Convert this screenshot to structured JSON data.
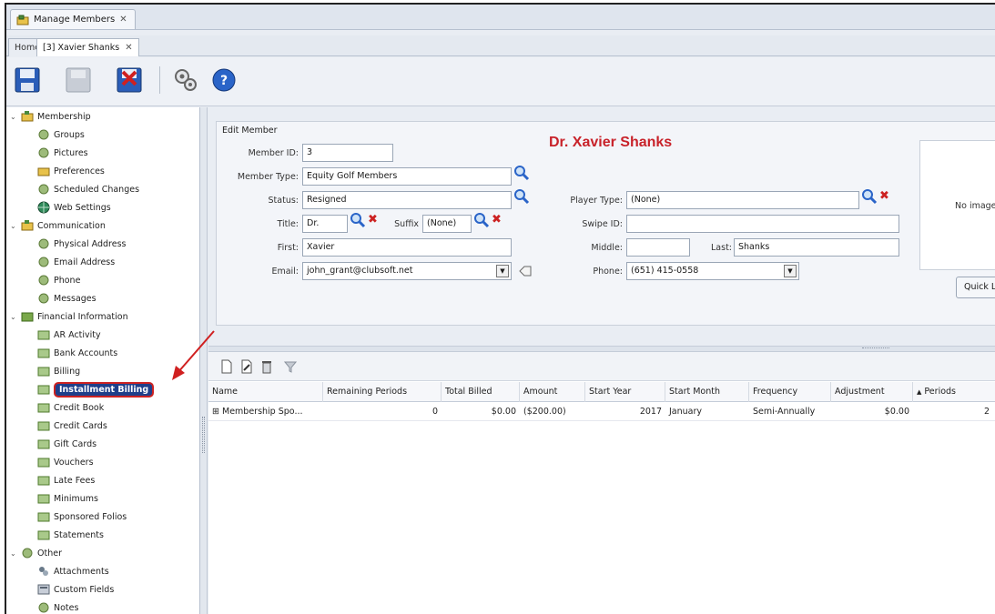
{
  "window": {
    "doc_tab": "Manage Members",
    "tabs": [
      {
        "label": "Home"
      },
      {
        "label": "[3] Xavier Shanks"
      }
    ]
  },
  "nav": {
    "groups": [
      {
        "label": "Membership",
        "items": [
          "Groups",
          "Pictures",
          "Preferences",
          "Scheduled Changes",
          "Web Settings"
        ]
      },
      {
        "label": "Communication",
        "items": [
          "Physical Address",
          "Email Address",
          "Phone",
          "Messages"
        ]
      },
      {
        "label": "Financial Information",
        "items": [
          "AR Activity",
          "Bank Accounts",
          "Billing",
          "Installment Billing",
          "Credit Book",
          "Credit Cards",
          "Gift Cards",
          "Vouchers",
          "Late Fees",
          "Minimums",
          "Sponsored Folios",
          "Statements"
        ]
      },
      {
        "label": "Other",
        "items": [
          "Attachments",
          "Custom Fields",
          "Notes"
        ]
      }
    ],
    "selected": "Installment Billing"
  },
  "edit_member": {
    "title": "Edit Member",
    "member_name": "Dr. Xavier Shanks",
    "labels": {
      "member_id": "Member ID:",
      "member_type": "Member Type:",
      "status": "Status:",
      "title": "Title:",
      "suffix": "Suffix",
      "first": "First:",
      "email": "Email:",
      "player_type": "Player Type:",
      "swipe_id": "Swipe ID:",
      "middle": "Middle:",
      "last": "Last:",
      "phone": "Phone:"
    },
    "values": {
      "member_id": "3",
      "member_type": "Equity Golf Members",
      "status": "Resigned",
      "title": "Dr.",
      "suffix": "(None)",
      "first": "Xavier",
      "email": "john_grant@clubsoft.net",
      "player_type": "(None)",
      "swipe_id": "",
      "middle": "",
      "last": "Shanks",
      "phone": "(651) 415-0558"
    },
    "no_image": "No image",
    "quick_button": "Quick La"
  },
  "grid": {
    "columns": [
      "Name",
      "Remaining Periods",
      "Total Billed",
      "Amount",
      "Start Year",
      "Start Month",
      "Frequency",
      "Adjustment",
      "Periods"
    ],
    "sort_indicator": "▲",
    "rows": [
      {
        "name": "Membership Spo...",
        "remaining_periods": "0",
        "total_billed": "$0.00",
        "amount": "($200.00)",
        "start_year": "2017",
        "start_month": "January",
        "frequency": "Semi-Annually",
        "adjustment": "$0.00",
        "periods": "2"
      }
    ],
    "expander": "⊞"
  },
  "colors": {
    "accent_red": "#c8222a",
    "selected_bg": "#1f3f8a",
    "icon_blue": "#2a64c8",
    "icon_green": "#7aa84a"
  }
}
